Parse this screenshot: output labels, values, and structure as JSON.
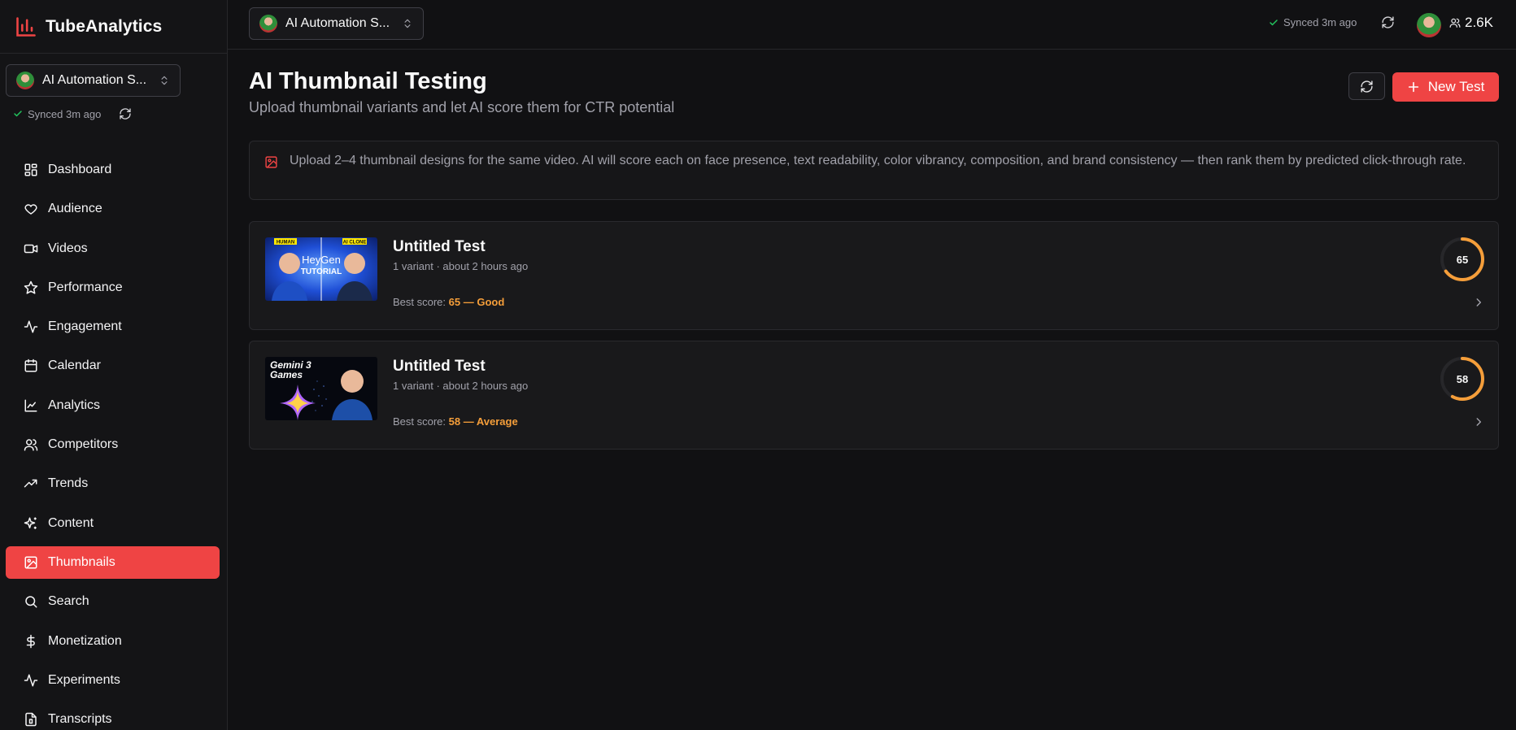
{
  "app": {
    "name": "TubeAnalytics",
    "accent": "#ef4444"
  },
  "channel": {
    "name": "AI Automation S...",
    "subscribers": "2.6K"
  },
  "sync": {
    "status": "Synced 3m ago"
  },
  "sidebar": {
    "items": [
      {
        "label": "Dashboard",
        "icon": "dashboard-icon"
      },
      {
        "label": "Audience",
        "icon": "heart-icon"
      },
      {
        "label": "Videos",
        "icon": "video-icon"
      },
      {
        "label": "Performance",
        "icon": "star-icon"
      },
      {
        "label": "Engagement",
        "icon": "activity-icon"
      },
      {
        "label": "Calendar",
        "icon": "calendar-icon"
      },
      {
        "label": "Analytics",
        "icon": "line-chart-icon"
      },
      {
        "label": "Competitors",
        "icon": "users-icon"
      },
      {
        "label": "Trends",
        "icon": "trending-up-icon"
      },
      {
        "label": "Content",
        "icon": "sparkles-icon"
      },
      {
        "label": "Thumbnails",
        "icon": "image-icon",
        "active": true
      },
      {
        "label": "Search",
        "icon": "search-icon"
      },
      {
        "label": "Monetization",
        "icon": "dollar-icon"
      },
      {
        "label": "Experiments",
        "icon": "activity-icon"
      },
      {
        "label": "Transcripts",
        "icon": "file-icon"
      }
    ]
  },
  "main": {
    "title": "AI Thumbnail Testing",
    "subtitle": "Upload thumbnail variants and let AI score them for CTR potential",
    "new_test_label": "New Test",
    "info": "Upload 2–4 thumbnail designs for the same video. AI will score each on face presence, text readability, color vibrancy, composition, and brand consistency — then rank them by predicted click-through rate.",
    "tests": [
      {
        "title": "Untitled Test",
        "meta": "1 variant · about 2 hours ago",
        "best_score_label": "Best score:",
        "best_score_value": "65 — Good",
        "score": 65,
        "score_text": "65",
        "thumb_texts": [
          "HUMAN",
          "AI CLONE",
          "HeyGen",
          "TUTORIAL"
        ]
      },
      {
        "title": "Untitled Test",
        "meta": "1 variant · about 2 hours ago",
        "best_score_label": "Best score:",
        "best_score_value": "58 — Average",
        "score": 58,
        "score_text": "58",
        "thumb_texts": [
          "Gemini 3",
          "Games"
        ]
      }
    ]
  }
}
